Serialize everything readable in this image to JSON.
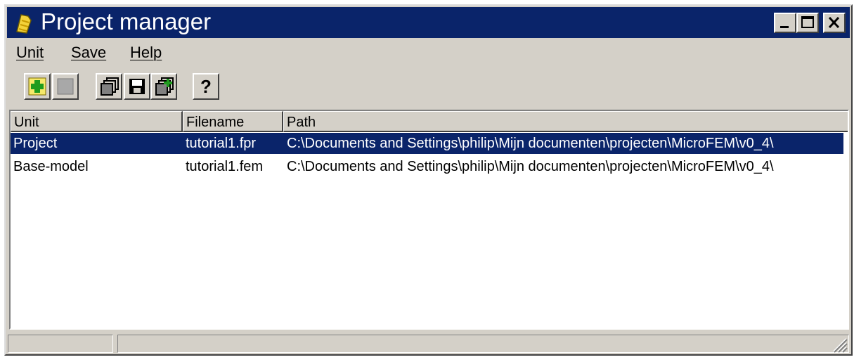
{
  "window": {
    "title": "Project manager",
    "controls": {
      "minimize": "_",
      "maximize": "□",
      "close": "×"
    },
    "titlebar_color": "#0a246a"
  },
  "menu": [
    {
      "label": "Unit",
      "icon": null
    },
    {
      "label": "Save",
      "icon": null
    },
    {
      "label": "Help",
      "icon": null
    }
  ],
  "toolbar": [
    {
      "icon": "add-unit-icon"
    },
    {
      "icon": "disabled-unit-icon"
    },
    {
      "icon": "open-copies-icon"
    },
    {
      "icon": "save-disk-icon"
    },
    {
      "icon": "add-copy-icon"
    },
    {
      "icon": "help-question-icon",
      "glyph": "?"
    }
  ],
  "table": {
    "columns": [
      "Unit",
      "Filename",
      "Path"
    ],
    "rows": [
      {
        "unit": "Project",
        "filename": "tutorial1.fpr",
        "path": "C:\\Documents and Settings\\philip\\Mijn documenten\\projecten\\MicroFEM\\v0_4\\",
        "selected": true
      },
      {
        "unit": "Base-model",
        "filename": "tutorial1.fem",
        "path": "C:\\Documents and Settings\\philip\\Mijn documenten\\projecten\\MicroFEM\\v0_4\\",
        "selected": false
      }
    ],
    "selection_color": "#0a246a"
  },
  "statusbar": {
    "panel1": "",
    "panel2": ""
  }
}
